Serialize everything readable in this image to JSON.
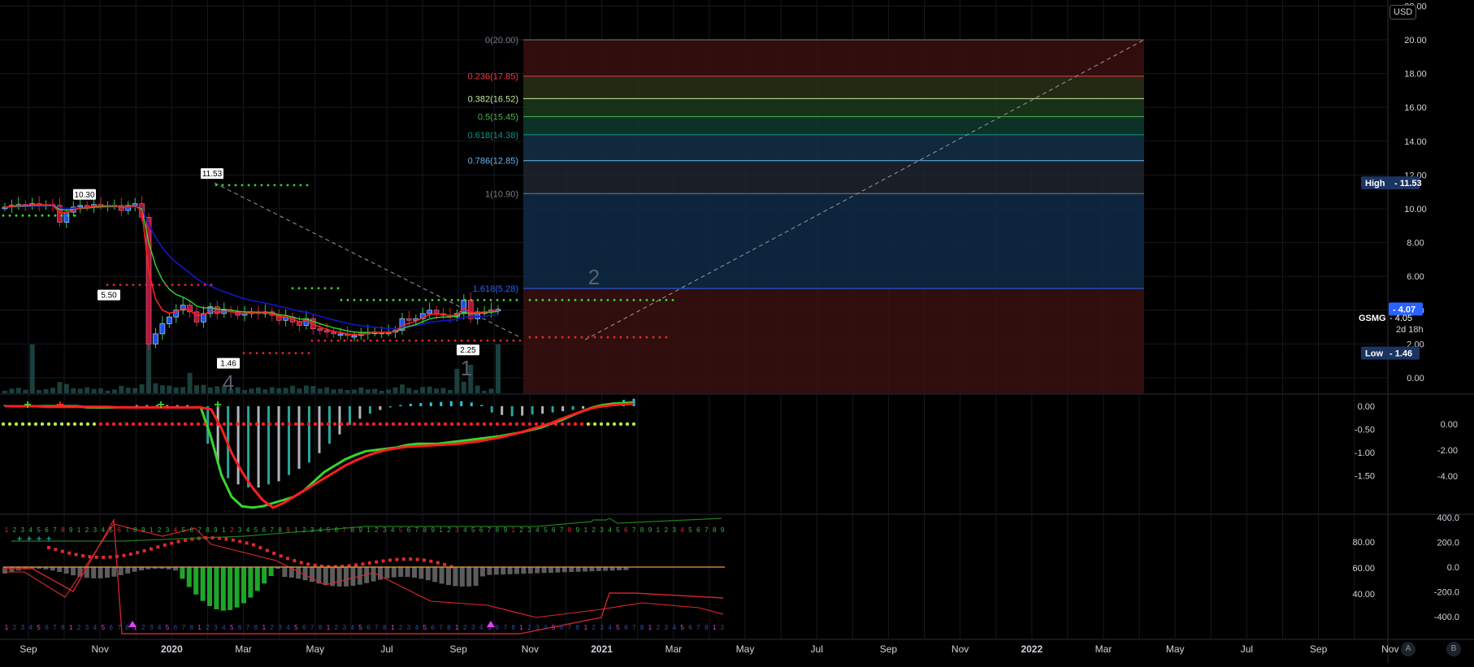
{
  "currency": "USD",
  "symbol": "GSMG",
  "countdown": "2d 18h",
  "last_price": "4.07",
  "symbol_value": "4.05",
  "high_label": "High",
  "high_value": "11.53",
  "low_label": "Low",
  "low_value": "1.46",
  "axis_buttons": [
    "A",
    "B"
  ],
  "chart_data": [
    {
      "type": "candlestick",
      "pane": "price",
      "x_tick_labels": [
        "Sep",
        "Nov",
        "2020",
        "Mar",
        "May",
        "Jul",
        "Sep",
        "Nov",
        "2021",
        "Mar",
        "May",
        "Jul",
        "Sep",
        "Nov",
        "2022",
        "Mar",
        "May",
        "Jul",
        "Sep",
        "Nov"
      ],
      "y_tick_labels": [
        "22.00",
        "20.00",
        "18.00",
        "16.00",
        "14.00",
        "12.00",
        "10.00",
        "8.00",
        "6.00",
        "4.00",
        "2.00",
        "0.00"
      ],
      "ylim": [
        0,
        22
      ],
      "colors": {
        "up": "#1e53e5",
        "down": "#b2163d",
        "ema_fast": "#ff1f1f",
        "ema_slow": "#1515c8",
        "ema_mid": "#36d62e"
      },
      "annotations": [
        {
          "text": "10.30",
          "x": "2019-10",
          "y": 10.3
        },
        {
          "text": "11.53",
          "x": "2020-02",
          "y": 11.53
        },
        {
          "text": "5.50",
          "x": "2019-11",
          "y": 5.5
        },
        {
          "text": "1.46",
          "x": "2020-02",
          "y": 1.46
        },
        {
          "text": "2.25",
          "x": "2020-09",
          "y": 2.25
        }
      ],
      "wave_labels": [
        "4",
        "1",
        "2"
      ],
      "fibonacci": {
        "from_price": 20.0,
        "to_price": 10.9,
        "levels": [
          {
            "label": "0(20.00)",
            "ratio": 0,
            "price": 20.0,
            "color": "#787b86"
          },
          {
            "label": "0.236(17.85)",
            "ratio": 0.236,
            "price": 17.85,
            "color": "#f23645"
          },
          {
            "label": "0.382(16.52)",
            "ratio": 0.382,
            "price": 16.52,
            "color": "#c8e6a0"
          },
          {
            "label": "0.5(15.45)",
            "ratio": 0.5,
            "price": 15.45,
            "color": "#4caf50"
          },
          {
            "label": "0.618(14.38)",
            "ratio": 0.618,
            "price": 14.38,
            "color": "#089981"
          },
          {
            "label": "0.786(12.85)",
            "ratio": 0.786,
            "price": 12.85,
            "color": "#64b5f6"
          },
          {
            "label": "1(10.90)",
            "ratio": 1,
            "price": 10.9,
            "color": "#787b86"
          },
          {
            "label": "1.618(5.28)",
            "ratio": 1.618,
            "price": 5.28,
            "color": "#2962ff"
          }
        ]
      },
      "closes": [
        10.1,
        10.2,
        10.25,
        10.2,
        10.3,
        10.2,
        10.25,
        10.2,
        9.2,
        9.8,
        10.1,
        10.2,
        10.1,
        10.25,
        10.2,
        10.2,
        10.2,
        9.9,
        10.2,
        10.3,
        9.5,
        2.0,
        2.6,
        3.2,
        3.6,
        4.0,
        4.3,
        3.9,
        3.3,
        3.8,
        4.2,
        3.8,
        4.0,
        3.9,
        3.7,
        3.8,
        3.9,
        3.8,
        3.9,
        3.7,
        3.4,
        3.6,
        3.3,
        3.1,
        3.5,
        2.9,
        2.8,
        2.7,
        2.6,
        2.6,
        2.5,
        2.5,
        2.6,
        2.7,
        2.7,
        2.7,
        2.7,
        2.8,
        3.5,
        3.4,
        3.5,
        3.8,
        4.0,
        3.8,
        3.7,
        3.6,
        3.8,
        4.6,
        3.5,
        3.9,
        3.9,
        4.0,
        4.05
      ]
    },
    {
      "type": "line",
      "pane": "oscillator-1",
      "y_tick_labels_left": [
        "0.00",
        "-0.50",
        "-1.00",
        "-1.50"
      ],
      "y_tick_labels_right": [
        "0.00",
        "-2.00",
        "-4.00"
      ],
      "series": [
        {
          "values": [
            0.0,
            0.0,
            0.0,
            0.0,
            0.0,
            0.0,
            0.0,
            0.0,
            -0.02,
            -0.02,
            -0.02,
            -0.02,
            -0.02,
            -0.02,
            -0.02,
            -0.02,
            -0.02,
            -0.02,
            -0.02,
            -0.02,
            -0.5,
            -1.1,
            -1.45,
            -1.6,
            -1.62,
            -1.6,
            -1.55,
            -1.5,
            -1.45,
            -1.35,
            -1.2,
            -1.05,
            -0.95,
            -0.85,
            -0.78,
            -0.72,
            -0.7,
            -0.68,
            -0.66,
            -0.62,
            -0.6,
            -0.6,
            -0.6,
            -0.58,
            -0.56,
            -0.54,
            -0.52,
            -0.5,
            -0.48,
            -0.45,
            -0.42,
            -0.38,
            -0.34,
            -0.28,
            -0.22,
            -0.15,
            -0.08,
            -0.02,
            0.02,
            0.04,
            0.05,
            0.06
          ]
        },
        {
          "values": [
            0.0,
            0.0,
            0.0,
            0.0,
            -0.01,
            -0.01,
            -0.01,
            -0.01,
            -0.01,
            -0.01,
            -0.01,
            -0.02,
            -0.02,
            -0.02,
            -0.02,
            -0.02,
            -0.02,
            -0.02,
            -0.02,
            -0.02,
            -0.05,
            -0.35,
            -0.75,
            -1.05,
            -1.3,
            -1.5,
            -1.62,
            -1.55,
            -1.45,
            -1.35,
            -1.25,
            -1.15,
            -1.05,
            -0.95,
            -0.87,
            -0.8,
            -0.74,
            -0.7,
            -0.67,
            -0.65,
            -0.64,
            -0.63,
            -0.62,
            -0.61,
            -0.6,
            -0.58,
            -0.56,
            -0.53,
            -0.5,
            -0.46,
            -0.42,
            -0.37,
            -0.32,
            -0.27,
            -0.2,
            -0.14,
            -0.08,
            -0.03,
            0.0,
            0.02,
            0.03,
            0.04
          ]
        }
      ],
      "histogram": [
        0.02,
        0.02,
        0.02,
        0.02,
        0.02,
        0.02,
        0.02,
        0.02,
        0.0,
        0.0,
        0.0,
        0.0,
        0.0,
        0.02,
        0.02,
        0.02,
        0.02,
        0.02,
        0.02,
        0.0,
        -0.6,
        -0.9,
        -1.15,
        -1.25,
        -1.3,
        -1.3,
        -1.25,
        -1.2,
        -1.1,
        -1.0,
        -0.9,
        -0.75,
        -0.6,
        -0.45,
        -0.3,
        -0.2,
        -0.12,
        -0.06,
        -0.02,
        0.02,
        0.04,
        0.05,
        0.06,
        0.07,
        0.08,
        0.08,
        0.06,
        0.02,
        -0.1,
        -0.14,
        -0.16,
        -0.15,
        -0.13,
        -0.12,
        -0.1,
        -0.08,
        -0.06,
        -0.04,
        -0.02,
        0.02,
        0.06,
        0.1,
        0.12
      ]
    },
    {
      "type": "bar",
      "pane": "oscillator-2",
      "y_tick_labels_left": [
        "80.00",
        "60.00",
        "40.00"
      ],
      "y_tick_labels_right": [
        "400.0",
        "200.0",
        "0.0",
        "-200.0",
        "-400.0"
      ]
    }
  ]
}
